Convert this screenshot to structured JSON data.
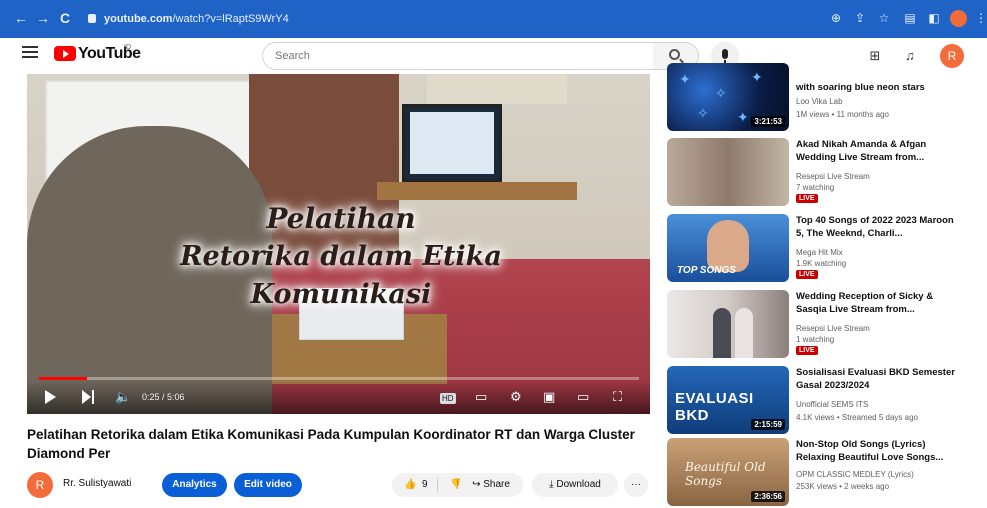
{
  "browser": {
    "url_host": "youtube.com",
    "url_rest": "/watch?v=lRaptS9WrY4",
    "nav_back": "←",
    "nav_forward": "→",
    "nav_reload": "C"
  },
  "header": {
    "logo_text": "YouTube",
    "logo_superscript": "ID",
    "search_placeholder": "Search",
    "avatar_letter": "R"
  },
  "player": {
    "overlay_line1": "Pelatihan",
    "overlay_line2": "Retorika dalam Etika Komunikasi",
    "time": "0:25 / 5:06",
    "progress": 0.08,
    "hd_label": "HD"
  },
  "video": {
    "title": "Pelatihan Retorika dalam Etika Komunikasi Pada Kumpulan Koordinator RT dan Warga Cluster Diamond Per",
    "channel_name": "Rr. Sulistyawati",
    "channel_initial": "R",
    "analytics_label": "Analytics",
    "edit_label": "Edit video",
    "like_count": "9",
    "share_label": "Share",
    "download_label": "Download",
    "more_label": "···"
  },
  "recommendations": [
    {
      "title": "with soaring blue neon stars",
      "channel": "Loo Vika Lab",
      "meta": "1M views • 11 months ago",
      "duration": "3:21:53"
    },
    {
      "title": "Akad Nikah Amanda & Afgan Wedding Live Stream from...",
      "channel": "Resepsi Live Stream",
      "meta": "7 watching",
      "live": "LIVE"
    },
    {
      "title": "Top 40 Songs of 2022 2023 Maroon 5, The Weeknd, Charli...",
      "channel": "Mega Hit Mix",
      "meta": "1.9K watching",
      "live": "LIVE",
      "thumb_text": "TOP SONGS"
    },
    {
      "title": "Wedding Reception of Sicky & Sasqia Live Stream from...",
      "channel": "Resepsi Live Stream",
      "meta": "1 watching",
      "live": "LIVE"
    },
    {
      "title": "Sosialisasi Evaluasi BKD Semester Gasal 2023/2024",
      "channel": "Unofficial SEMS ITS",
      "meta": "4.1K views • Streamed 5 days ago",
      "duration": "2:15:59",
      "thumb_text": "EVALUASI BKD"
    },
    {
      "title": "Non-Stop Old Songs (Lyrics) Relaxing Beautiful Love Songs...",
      "channel": "OPM CLASSIC MEDLEY (Lyrics)",
      "meta": "253K views • 2 weeks ago",
      "duration": "2:36:56",
      "thumb_text": "Beautiful Old Songs"
    }
  ],
  "colors": {
    "browser_bar": "#1f63c6",
    "brand_red": "#ff0000",
    "primary_blue": "#0a5fd6",
    "avatar_orange": "#f26b3a"
  }
}
